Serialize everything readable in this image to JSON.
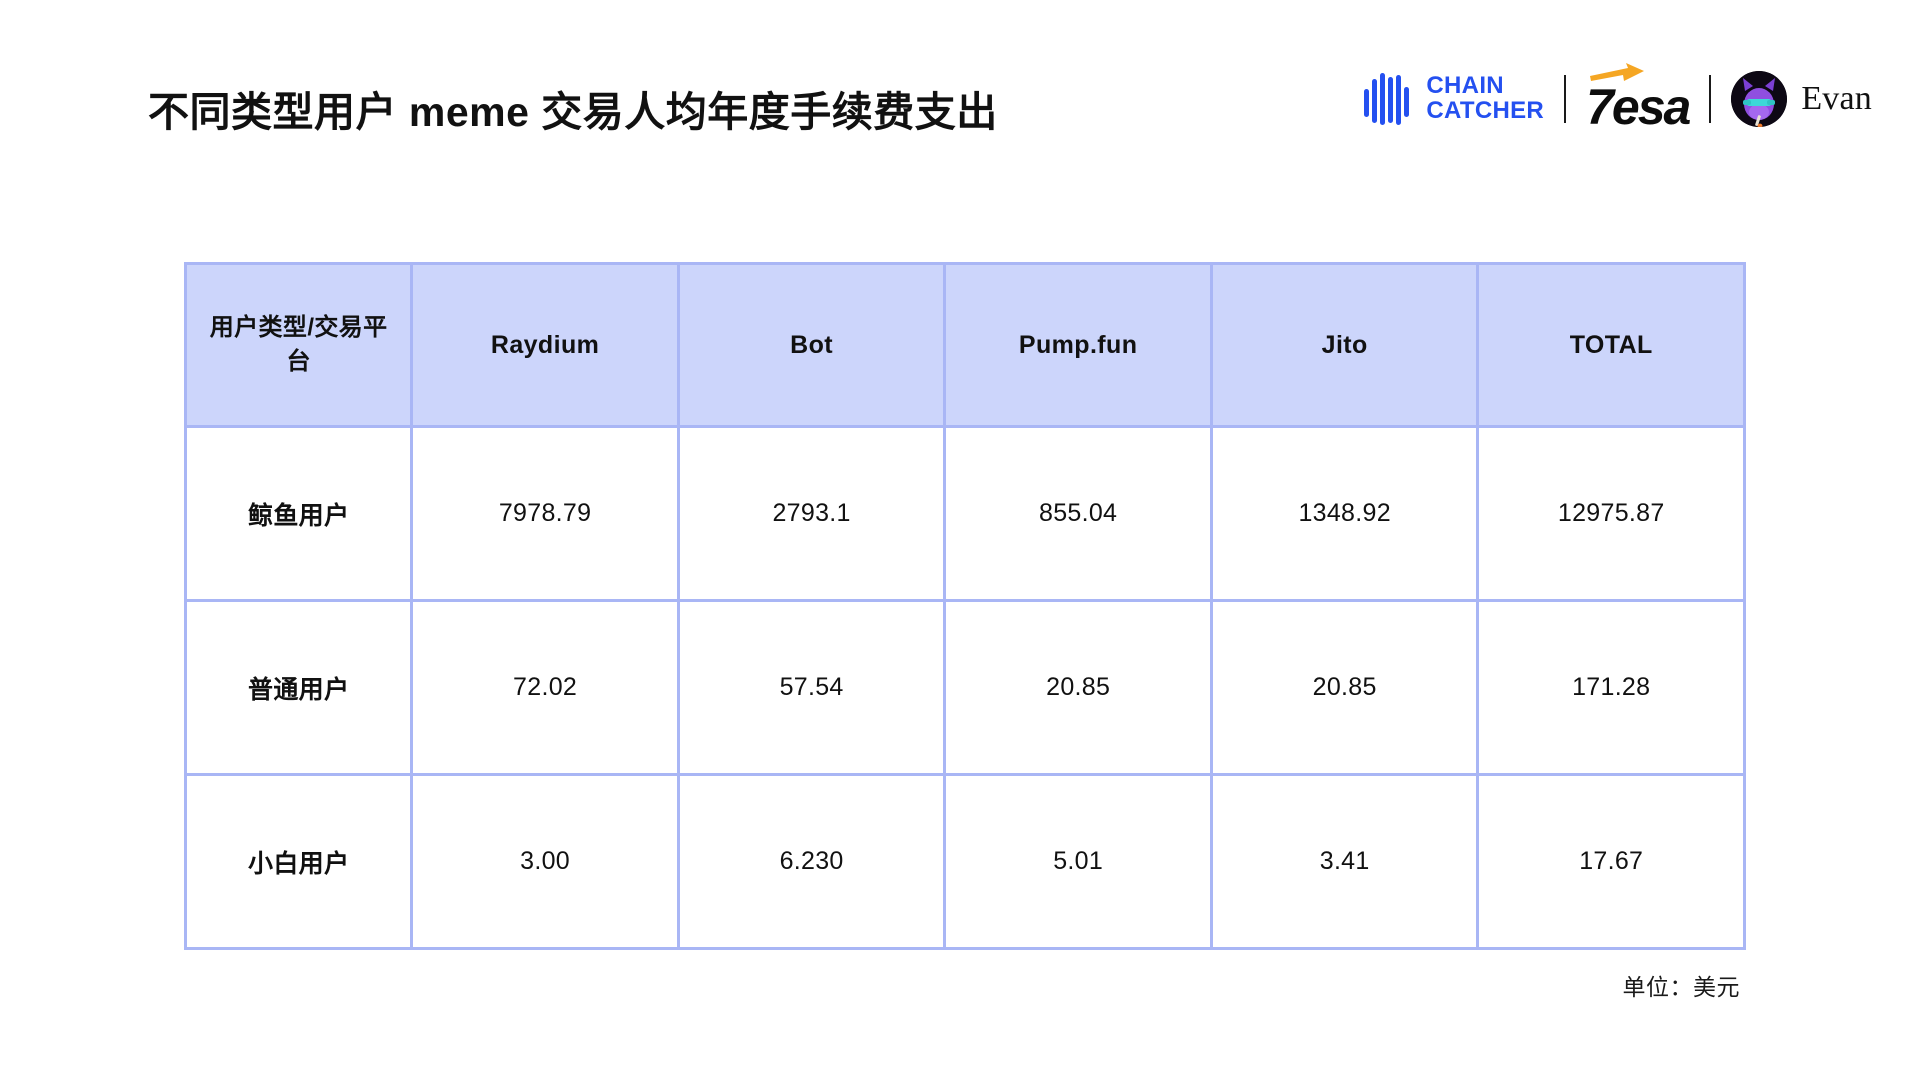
{
  "header": {
    "title": "不同类型用户 meme 交易人均年度手续费支出",
    "brands": {
      "chaincatcher": {
        "line1": "CHAIN",
        "line2": "CATCHER",
        "color": "#2450f0",
        "mark": "chaincatcher-bars-icon"
      },
      "tesa": {
        "wordmark": "esa",
        "lead": "7",
        "arrow_color": "#f5a623",
        "text_color": "#0d0d0d"
      },
      "evan": {
        "name": "Evan",
        "avatar": "evan-purple-cat-avatar"
      }
    }
  },
  "chart_data": {
    "type": "table",
    "title": "不同类型用户 meme 交易人均年度手续费支出",
    "unit_note": "单位：美元",
    "columns": [
      "用户类型/交易平台",
      "Raydium",
      "Bot",
      "Pump.fun",
      "Jito",
      "TOTAL"
    ],
    "rows": [
      {
        "label": "鲸鱼用户",
        "values": [
          "7978.79",
          "2793.1",
          "855.04",
          "1348.92",
          "12975.87"
        ]
      },
      {
        "label": "普通用户",
        "values": [
          "72.02",
          "57.54",
          "20.85",
          "20.85",
          "171.28"
        ]
      },
      {
        "label": "小白用户",
        "values": [
          "3.00",
          "6.230",
          "5.01",
          "3.41",
          "17.67"
        ]
      }
    ],
    "colors": {
      "header_fill": "#ccd5fb",
      "border": "#a9b6f5",
      "body_fill": "#ffffff",
      "text": "#111111"
    }
  },
  "footer": {
    "unit_note": "单位：美元"
  }
}
